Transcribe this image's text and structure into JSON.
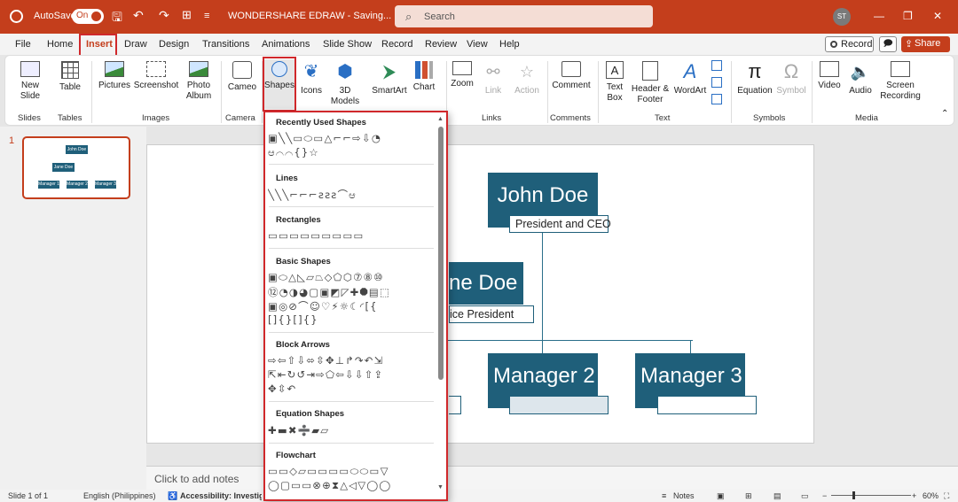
{
  "titlebar": {
    "autosave_label": "AutoSave",
    "toggle": "On",
    "doc_title": "WONDERSHARE EDRAW - Saving...",
    "search_placeholder": "Search",
    "user_initials": "ST"
  },
  "tabs": [
    "File",
    "Home",
    "Insert",
    "Draw",
    "Design",
    "Transitions",
    "Animations",
    "Slide Show",
    "Record",
    "Review",
    "View",
    "Help"
  ],
  "actions": {
    "record": "Record",
    "share": "Share"
  },
  "ribbon": {
    "new_slide": "New Slide",
    "table": "Table",
    "pictures": "Pictures",
    "screenshot": "Screenshot",
    "photo_album": "Photo Album",
    "cameo": "Cameo",
    "shapes": "Shapes",
    "icons": "Icons",
    "models_3d": "3D Models",
    "smartart": "SmartArt",
    "chart": "Chart",
    "zoom": "Zoom",
    "link": "Link",
    "action": "Action",
    "comment": "Comment",
    "text_box": "Text Box",
    "header_footer": "Header & Footer",
    "wordart": "WordArt",
    "equation": "Equation",
    "symbol": "Symbol",
    "video": "Video",
    "audio": "Audio",
    "screen_recording": "Screen Recording",
    "groups": {
      "slides": "Slides",
      "tables": "Tables",
      "images": "Images",
      "camera": "Camera",
      "links": "Links",
      "comments": "Comments",
      "text": "Text",
      "symbols": "Symbols",
      "media": "Media"
    }
  },
  "thumbnail": {
    "number": "1",
    "top": "John Doe",
    "mid": "Jane Doe",
    "m1": "Manager 1",
    "m2": "Manager 2",
    "m3": "Manager 3"
  },
  "slide": {
    "john": "John Doe",
    "john_title": "President and CEO",
    "jane": "ne Doe",
    "jane_title": "ice President",
    "manager2": "Manager 2",
    "manager3": "Manager 3"
  },
  "shapes_menu": {
    "sections": [
      {
        "title": "Recently Used Shapes",
        "rows": [
          "▣╲╲▭⬭▭△⌐⌐⇨⇩◔",
          "ಆ⌒⌒{}☆"
        ]
      },
      {
        "title": "Lines",
        "rows": [
          "╲╲╲⌐⌐⌐ƨƨƨ⌒ಆ"
        ]
      },
      {
        "title": "Rectangles",
        "rows": [
          "▭▭▭▭▭▭▭▭▭"
        ]
      },
      {
        "title": "Basic Shapes",
        "rows": [
          "▣⬭△◺▱⏢◇⬠⬡⑦⑧⑩",
          "⑫◔◑◕▢▣◩◸✚⯃▤⬚",
          "▣◎⊘⌒☺♡⚡☼☾◜[{",
          "[]{}[]{}"
        ]
      },
      {
        "title": "Block Arrows",
        "rows": [
          "⇨⇦⇧⇩⬄⇳✥⊥↱↷↶⇲",
          "⇱⇤↻↺⇥⇨⬠⇦⇩⇩⇧⇪",
          "✥⇳↶"
        ]
      },
      {
        "title": "Equation Shapes",
        "rows": [
          "✚▬✖➗▰▱"
        ]
      },
      {
        "title": "Flowchart",
        "rows": [
          "▭▭◇▱▭▭▭▭⬭⬭▭▽",
          "◯▢▭▭⊗⊕⧗△◁▽◯◯"
        ]
      }
    ]
  },
  "notes": {
    "placeholder": "Click to add notes"
  },
  "status": {
    "slide": "Slide 1 of 1",
    "language": "English (Philippines)",
    "accessibility": "Accessibility: Investigat",
    "notes": "Notes",
    "zoom": "60%"
  }
}
